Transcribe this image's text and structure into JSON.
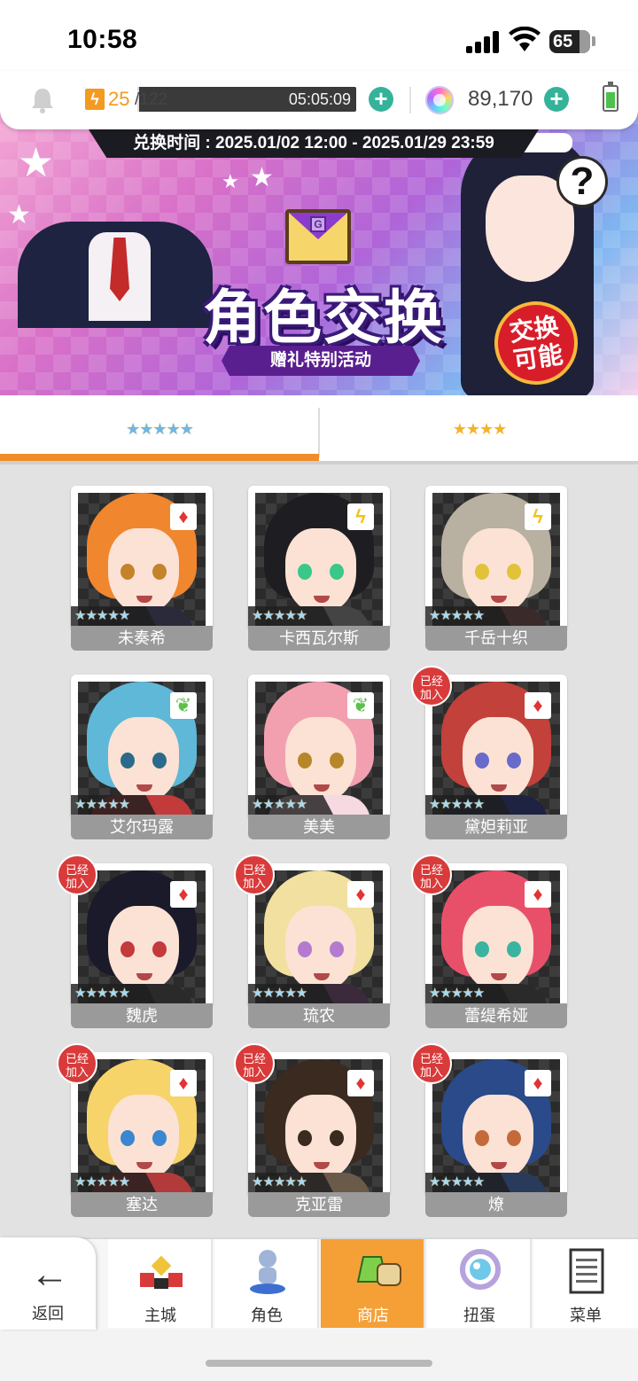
{
  "status_bar": {
    "time": "10:58",
    "battery": "65"
  },
  "resources": {
    "stamina_current": "25",
    "stamina_max": "/122",
    "stamina_fraction": 0.205,
    "stamina_timer": "05:05:09",
    "gems": "89,170"
  },
  "banner": {
    "period": "兑换时间 : 2025.01/02 12:00 - 2025.01/29 23:59",
    "title": "角色交换",
    "subtitle": "赠礼特别活动",
    "badge": "交换\n可能",
    "envelope_letter": "G"
  },
  "tabs": {
    "five_star": "★★★★★",
    "four_star": "★★★★"
  },
  "rarity": "★★★★★",
  "joined_label": "已经\n加入",
  "colors": {
    "accent": "#f08d2a",
    "nav_active": "#f5a036",
    "joined": "#d93a3a",
    "plus": "#35b39a"
  },
  "characters": [
    {
      "name": "未奏希",
      "attribute": "flame",
      "joined": false
    },
    {
      "name": "卡西瓦尔斯",
      "attribute": "bolt",
      "joined": false
    },
    {
      "name": "千岳十织",
      "attribute": "bolt",
      "joined": false
    },
    {
      "name": "艾尔玛露",
      "attribute": "leaf",
      "joined": false
    },
    {
      "name": "美美",
      "attribute": "leaf",
      "joined": false
    },
    {
      "name": "黛妲莉亚",
      "attribute": "flame",
      "joined": true
    },
    {
      "name": "魏虎",
      "attribute": "flame",
      "joined": true
    },
    {
      "name": "琉农",
      "attribute": "flame",
      "joined": true
    },
    {
      "name": "蕾缇希娅",
      "attribute": "flame",
      "joined": true
    },
    {
      "name": "塞达",
      "attribute": "flame",
      "joined": true
    },
    {
      "name": "克亚雷",
      "attribute": "flame",
      "joined": true
    },
    {
      "name": "燎",
      "attribute": "flame",
      "joined": true
    }
  ],
  "nav": {
    "back": "返回",
    "items": [
      {
        "label": "主城",
        "icon": "castle-icon"
      },
      {
        "label": "角色",
        "icon": "character-icon"
      },
      {
        "label": "商店",
        "icon": "shop-icon",
        "active": true
      },
      {
        "label": "扭蛋",
        "icon": "gacha-icon"
      },
      {
        "label": "菜单",
        "icon": "menu-icon"
      }
    ]
  }
}
